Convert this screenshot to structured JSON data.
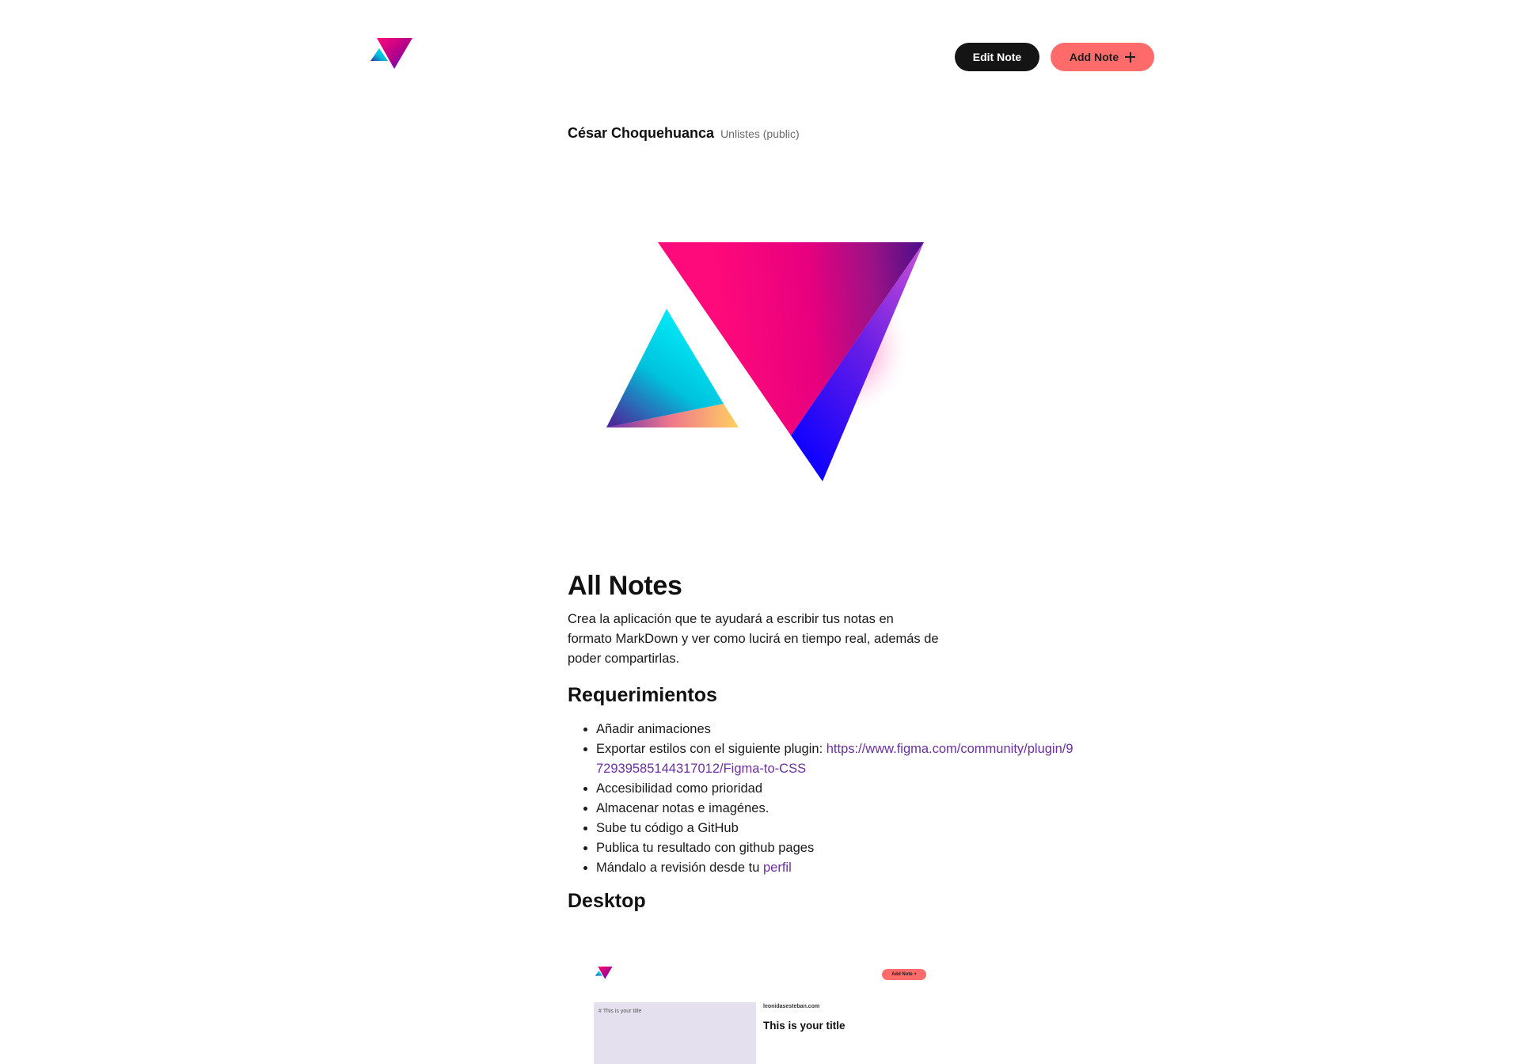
{
  "header": {
    "logo_icon": "prism-triangles-logo",
    "edit_label": "Edit Note",
    "add_label": "Add Note",
    "add_icon": "plus-icon"
  },
  "author": {
    "name": "César Choquehuanca",
    "status": "Unlistes (public)"
  },
  "hero": {
    "icon": "prism-triangles-illustration"
  },
  "note": {
    "title": "All Notes",
    "intro": "Crea la aplicación que te ayudará a escribir tus notas en formato MarkDown y ver como lucirá en tiempo real, además de poder compartirlas.",
    "requirements_title": "Requerimientos",
    "requirements": {
      "item1": "Añadir animaciones",
      "item2_text": "Exportar estilos con el siguiente plugin: ",
      "item2_link": "https://www.figma.com/community/plugin/972939585144317012/Figma-to-CSS",
      "item3": "Accesibilidad como prioridad",
      "item4": "Almacenar notas e imagénes.",
      "item5": "Sube tu código a GitHub",
      "item6": "Publica tu resultado con github pages",
      "item7_text": "Mándalo a revisión desde tu ",
      "item7_link": "perfil"
    },
    "desktop_title": "Desktop"
  },
  "preview": {
    "button_label": "Add Note +",
    "editor_text": "# This is your title",
    "site_label": "leonidasesteban.com",
    "title": "This is your title"
  },
  "colors": {
    "dark_button": "#141414",
    "coral_button": "#ff6b6b",
    "link": "#6a2fa0",
    "preview_editor_bg": "#e5e0ee"
  }
}
